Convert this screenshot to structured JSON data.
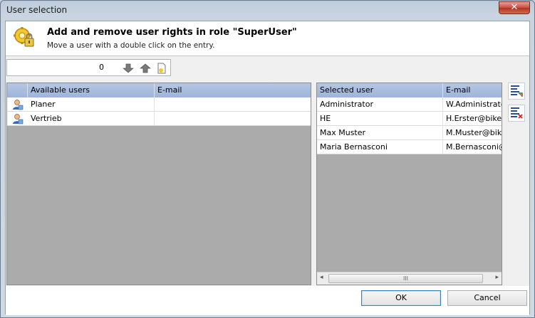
{
  "window": {
    "title": "User selection"
  },
  "header": {
    "title": "Add and remove user rights in role \"SuperUser\"",
    "subtitle": "Move a user with a double click on the entry."
  },
  "toolbar": {
    "counter_value": "0",
    "icons": [
      "arrow-down-icon",
      "arrow-up-icon",
      "new-document-icon"
    ]
  },
  "available": {
    "columns": [
      "Available users",
      "E-mail"
    ],
    "rows": [
      {
        "name": "Planer",
        "email": ""
      },
      {
        "name": "Vertrieb",
        "email": ""
      }
    ]
  },
  "selected": {
    "columns": [
      "Selected user",
      "E-mail"
    ],
    "rows": [
      {
        "name": "Administrator",
        "email": "W.Administrato"
      },
      {
        "name": "HE",
        "email": "H.Erster@bike.c"
      },
      {
        "name": "Max Muster",
        "email": "M.Muster@bike"
      },
      {
        "name": "Maria Bernasconi",
        "email": "M.Bernasconi@"
      }
    ],
    "scroll_grip": "III"
  },
  "side_buttons": [
    "add-to-selection-icon",
    "remove-from-selection-icon"
  ],
  "buttons": {
    "ok": "OK",
    "cancel": "Cancel"
  },
  "colors": {
    "grid_header": "#a9bde0",
    "empty_grid": "#ababab",
    "close": "#c74f3d"
  }
}
